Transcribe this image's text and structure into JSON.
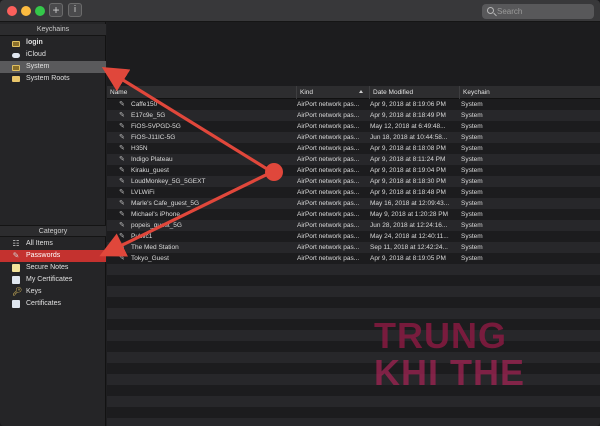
{
  "toolbar": {
    "add_label": "+",
    "info_label": "i",
    "search_placeholder": "Search"
  },
  "sidebar": {
    "keychains_heading": "Keychains",
    "keychains": [
      {
        "label": "login",
        "icon": "lock-icon"
      },
      {
        "label": "iCloud",
        "icon": "cloud-icon"
      },
      {
        "label": "System",
        "icon": "lock-icon"
      },
      {
        "label": "System Roots",
        "icon": "folder-icon"
      }
    ],
    "category_heading": "Category",
    "categories": [
      {
        "label": "All Items",
        "icon": "all-items-icon"
      },
      {
        "label": "Passwords",
        "icon": "pen-icon"
      },
      {
        "label": "Secure Notes",
        "icon": "note-icon"
      },
      {
        "label": "My Certificates",
        "icon": "certificate-icon"
      },
      {
        "label": "Keys",
        "icon": "key-icon"
      },
      {
        "label": "Certificates",
        "icon": "certificate-icon"
      }
    ]
  },
  "table": {
    "columns": [
      "Name",
      "Kind",
      "Date Modified",
      "Keychain"
    ],
    "rows": [
      [
        "Caffe150",
        "AirPort network pas...",
        "Apr 9, 2018 at 8:19:06 PM",
        "System"
      ],
      [
        "E17c9e_5G",
        "AirPort network pas...",
        "Apr 9, 2018 at 8:18:49 PM",
        "System"
      ],
      [
        "FiOS-5VPGD-5G",
        "AirPort network pas...",
        "May 12, 2018 at 6:49:48...",
        "System"
      ],
      [
        "FiOS-J11IC-5G",
        "AirPort network pas...",
        "Jun 18, 2018 at 10:44:58...",
        "System"
      ],
      [
        "H35N",
        "AirPort network pas...",
        "Apr 9, 2018 at 8:18:08 PM",
        "System"
      ],
      [
        "Indigo Plateau",
        "AirPort network pas...",
        "Apr 9, 2018 at 8:11:24 PM",
        "System"
      ],
      [
        "Kiraku_guest",
        "AirPort network pas...",
        "Apr 9, 2018 at 8:19:04 PM",
        "System"
      ],
      [
        "LoudMonkey_5G_5GEXT",
        "AirPort network pas...",
        "Apr 9, 2018 at 8:18:30 PM",
        "System"
      ],
      [
        "LVLWiFi",
        "AirPort network pas...",
        "Apr 9, 2018 at 8:18:48 PM",
        "System"
      ],
      [
        "Marle's Cafe_guest_5G",
        "AirPort network pas...",
        "May 16, 2018 at 12:09:43...",
        "System"
      ],
      [
        "Michael's iPhone",
        "AirPort network pas...",
        "May 9, 2018 at 1:20:28 PM",
        "System"
      ],
      [
        "popeis_guest_5G",
        "AirPort network pas...",
        "Jun 28, 2018 at 12:24:16...",
        "System"
      ],
      [
        "Public1",
        "AirPort network pas...",
        "May 24, 2018 at 12:40:11...",
        "System"
      ],
      [
        "The Med Station",
        "AirPort network pas...",
        "Sep 11, 2018 at 12:42:24...",
        "System"
      ],
      [
        "Tokyo_Guest",
        "AirPort network pas...",
        "Apr 9, 2018 at 8:19:05 PM",
        "System"
      ]
    ]
  },
  "watermark": {
    "line1": "TRUNG",
    "line2": "KHI THE"
  },
  "colors": {
    "selection_red": "#c4322f",
    "annotation_red": "#e0473b"
  }
}
